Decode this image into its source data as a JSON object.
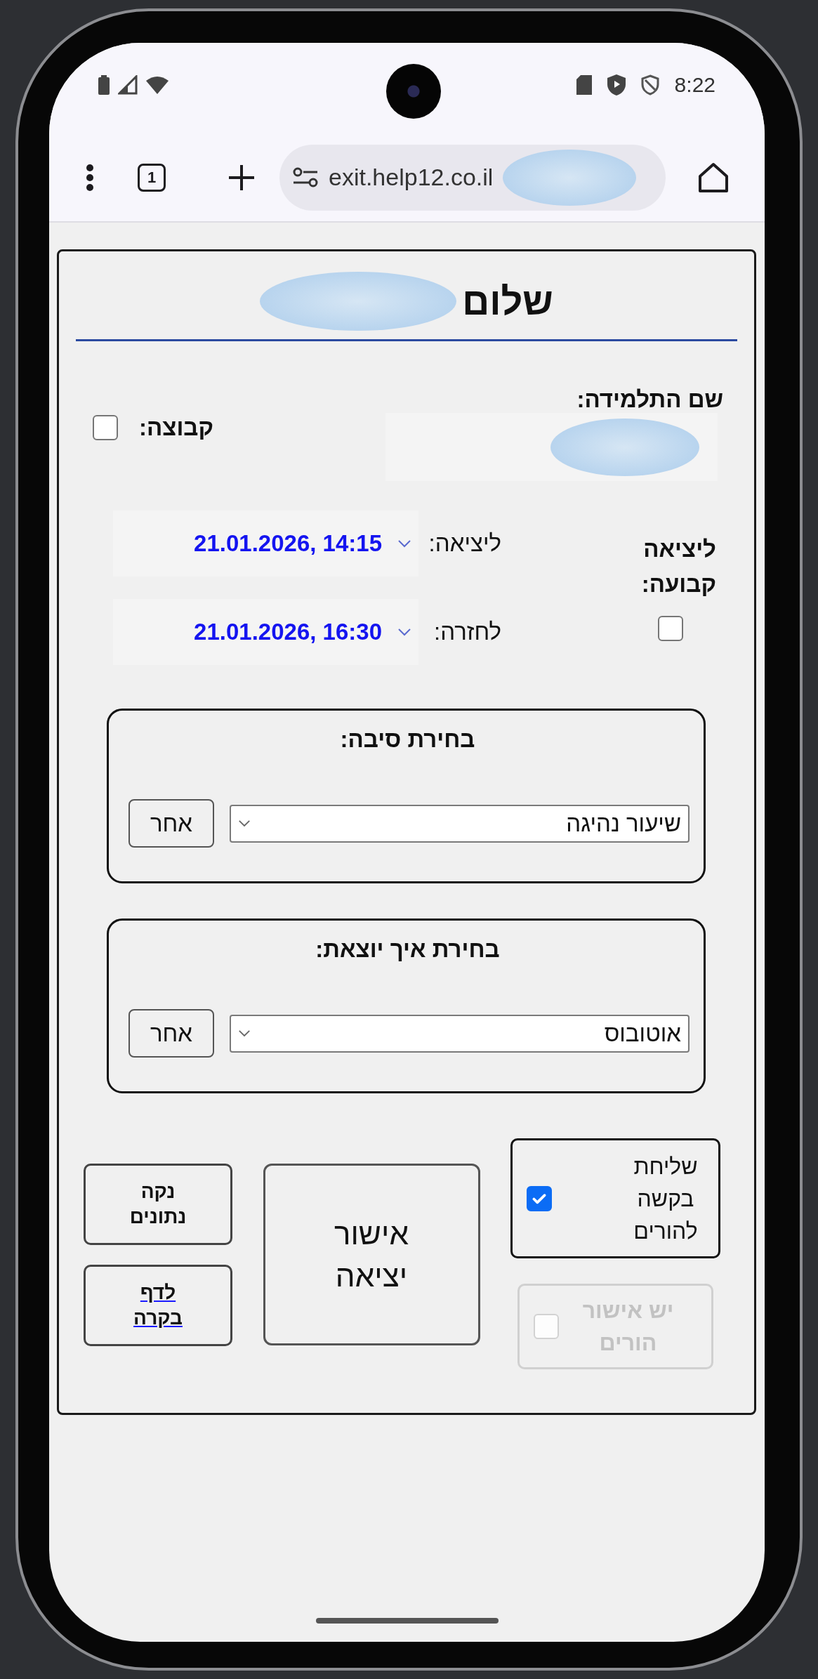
{
  "status_bar": {
    "time": "8:22"
  },
  "browser": {
    "tab_count": "1",
    "url": "exit.help12.co.il"
  },
  "page": {
    "greeting": "שלום",
    "student_label": "שם התלמידה:",
    "group": {
      "label": "קבוצה:",
      "checked": false
    },
    "times": [
      {
        "label": "ליציאה:",
        "value": "21.01.2026, 14:15"
      },
      {
        "label": "לחזרה:",
        "value": "21.01.2026, 16:30"
      }
    ],
    "fixed_exit": {
      "label": "ליציאה קבועה:",
      "checked": false
    },
    "sections": [
      {
        "legend": "בחירת סיבה:",
        "value": "שיעור נהיגה",
        "other_button": "אחר"
      },
      {
        "legend": "בחירת איך יוצאת:",
        "value": "אוטובוס",
        "other_button": "אחר"
      }
    ],
    "parent_request": {
      "label": "שליחת בקשה להורים",
      "checked": true,
      "disabled": false
    },
    "parent_approval": {
      "label": "יש אישור הורים",
      "checked": false,
      "disabled": true
    },
    "approve_button": "אישור יציאה",
    "clear_button": "נקה נתונים",
    "control_link": "לדף בקרה"
  }
}
